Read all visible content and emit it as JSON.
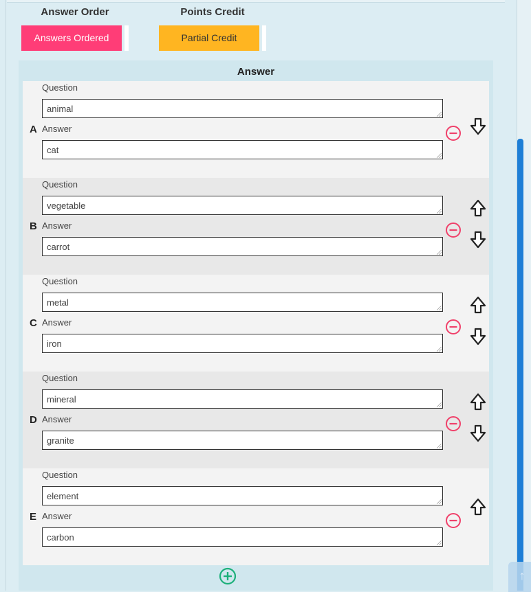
{
  "options": {
    "answer_order_label": "Answer Order",
    "answer_order_value": "Answers Ordered",
    "points_credit_label": "Points Credit",
    "points_credit_value": "Partial Credit"
  },
  "answers": {
    "header": "Answer",
    "question_label": "Question",
    "answer_label": "Answer",
    "rows": [
      {
        "letter": "A",
        "question": "animal",
        "answer": "cat"
      },
      {
        "letter": "B",
        "question": "vegetable",
        "answer": "carrot"
      },
      {
        "letter": "C",
        "question": "metal",
        "answer": "iron"
      },
      {
        "letter": "D",
        "question": "mineral",
        "answer": "granite"
      },
      {
        "letter": "E",
        "question": "element",
        "answer": "carbon"
      }
    ]
  },
  "colors": {
    "pink": "#ff3d77",
    "yellow": "#ffb521",
    "remove": "#f0406a",
    "add": "#1cb07a",
    "scroll": "#1e7fd6"
  },
  "icons": {
    "remove": "minus-circle-icon",
    "add": "plus-circle-icon",
    "up": "arrow-up-icon",
    "down": "arrow-down-icon"
  }
}
